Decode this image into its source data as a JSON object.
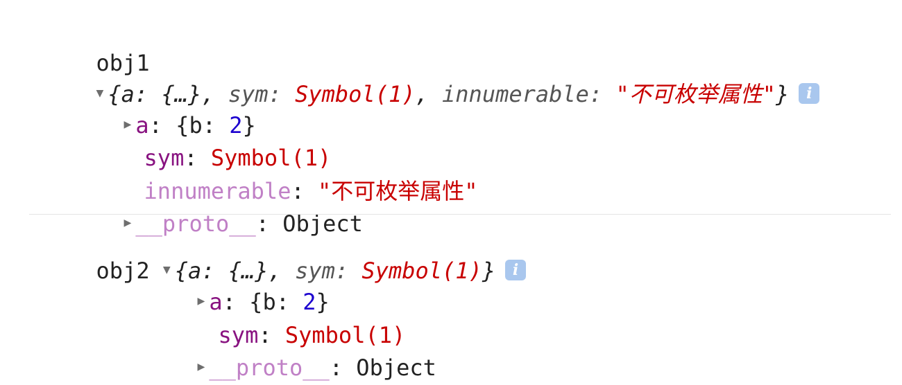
{
  "console": {
    "obj1": {
      "label": "obj1",
      "preview_open": "{",
      "preview_a": "a: {…}",
      "preview_comma1": ", ",
      "preview_sym_key": "sym: ",
      "preview_sym_val": "Symbol(1)",
      "preview_comma2": ", ",
      "preview_inn_key": "innumerable: ",
      "preview_inn_val": "\"不可枚举属性\"",
      "preview_close": "}",
      "prop_a_key": "a",
      "prop_a_val_open": ": {b: ",
      "prop_a_val_num": "2",
      "prop_a_val_close": "}",
      "prop_sym_key": "sym",
      "prop_sym_colon": ": ",
      "prop_sym_val": "Symbol(1)",
      "prop_inn_key": "innumerable",
      "prop_inn_colon": ": ",
      "prop_inn_val": "\"不可枚举属性\"",
      "proto_key": "__proto__",
      "proto_colon": ": ",
      "proto_val": "Object"
    },
    "obj2": {
      "label": "obj2 ",
      "preview_open": "{",
      "preview_a": "a: {…}",
      "preview_comma1": ", ",
      "preview_sym_key": "sym: ",
      "preview_sym_val": "Symbol(1)",
      "preview_close": "}",
      "prop_a_key": "a",
      "prop_a_val_open": ": {b: ",
      "prop_a_val_num": "2",
      "prop_a_val_close": "}",
      "prop_sym_key": "sym",
      "prop_sym_colon": ": ",
      "prop_sym_val": "Symbol(1)",
      "proto_key": "__proto__",
      "proto_colon": ": ",
      "proto_val": "Object"
    },
    "info_icon_glyph": "i"
  },
  "colors": {
    "key": "#881280",
    "key_nonenumerable": "#c080c6",
    "string_symbol": "#c80000",
    "number": "#1c00cf",
    "info_icon_bg": "#a9c7ee"
  },
  "icons": {
    "expanded_arrow": "triangle-down-icon",
    "collapsed_arrow": "triangle-right-icon",
    "info": "info-icon"
  }
}
